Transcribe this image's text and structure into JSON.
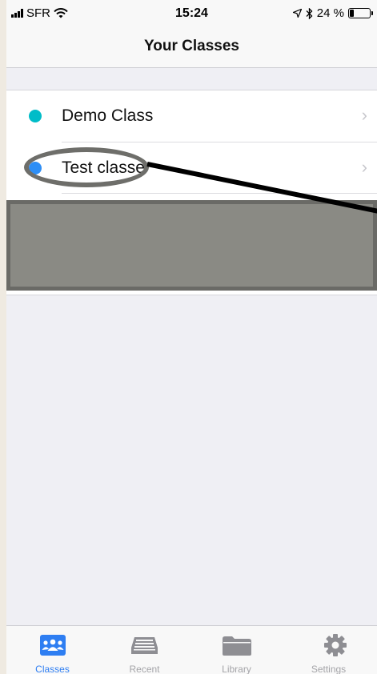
{
  "status_bar": {
    "carrier": "SFR",
    "time": "15:24",
    "battery": "24 %",
    "battery_level": 0.24
  },
  "nav": {
    "title": "Your Classes"
  },
  "classes": [
    {
      "label": "Demo Class",
      "color": "#00bcc8"
    },
    {
      "label": "Test classe",
      "color": "#2e8ef5"
    }
  ],
  "tabs": [
    {
      "label": "Classes",
      "icon": "people-icon",
      "active": true
    },
    {
      "label": "Recent",
      "icon": "tray-icon",
      "active": false
    },
    {
      "label": "Library",
      "icon": "folder-icon",
      "active": false
    },
    {
      "label": "Settings",
      "icon": "gear-icon",
      "active": false
    }
  ],
  "colors": {
    "accent": "#2e7ef2",
    "annotation": "#6e6e6a"
  }
}
